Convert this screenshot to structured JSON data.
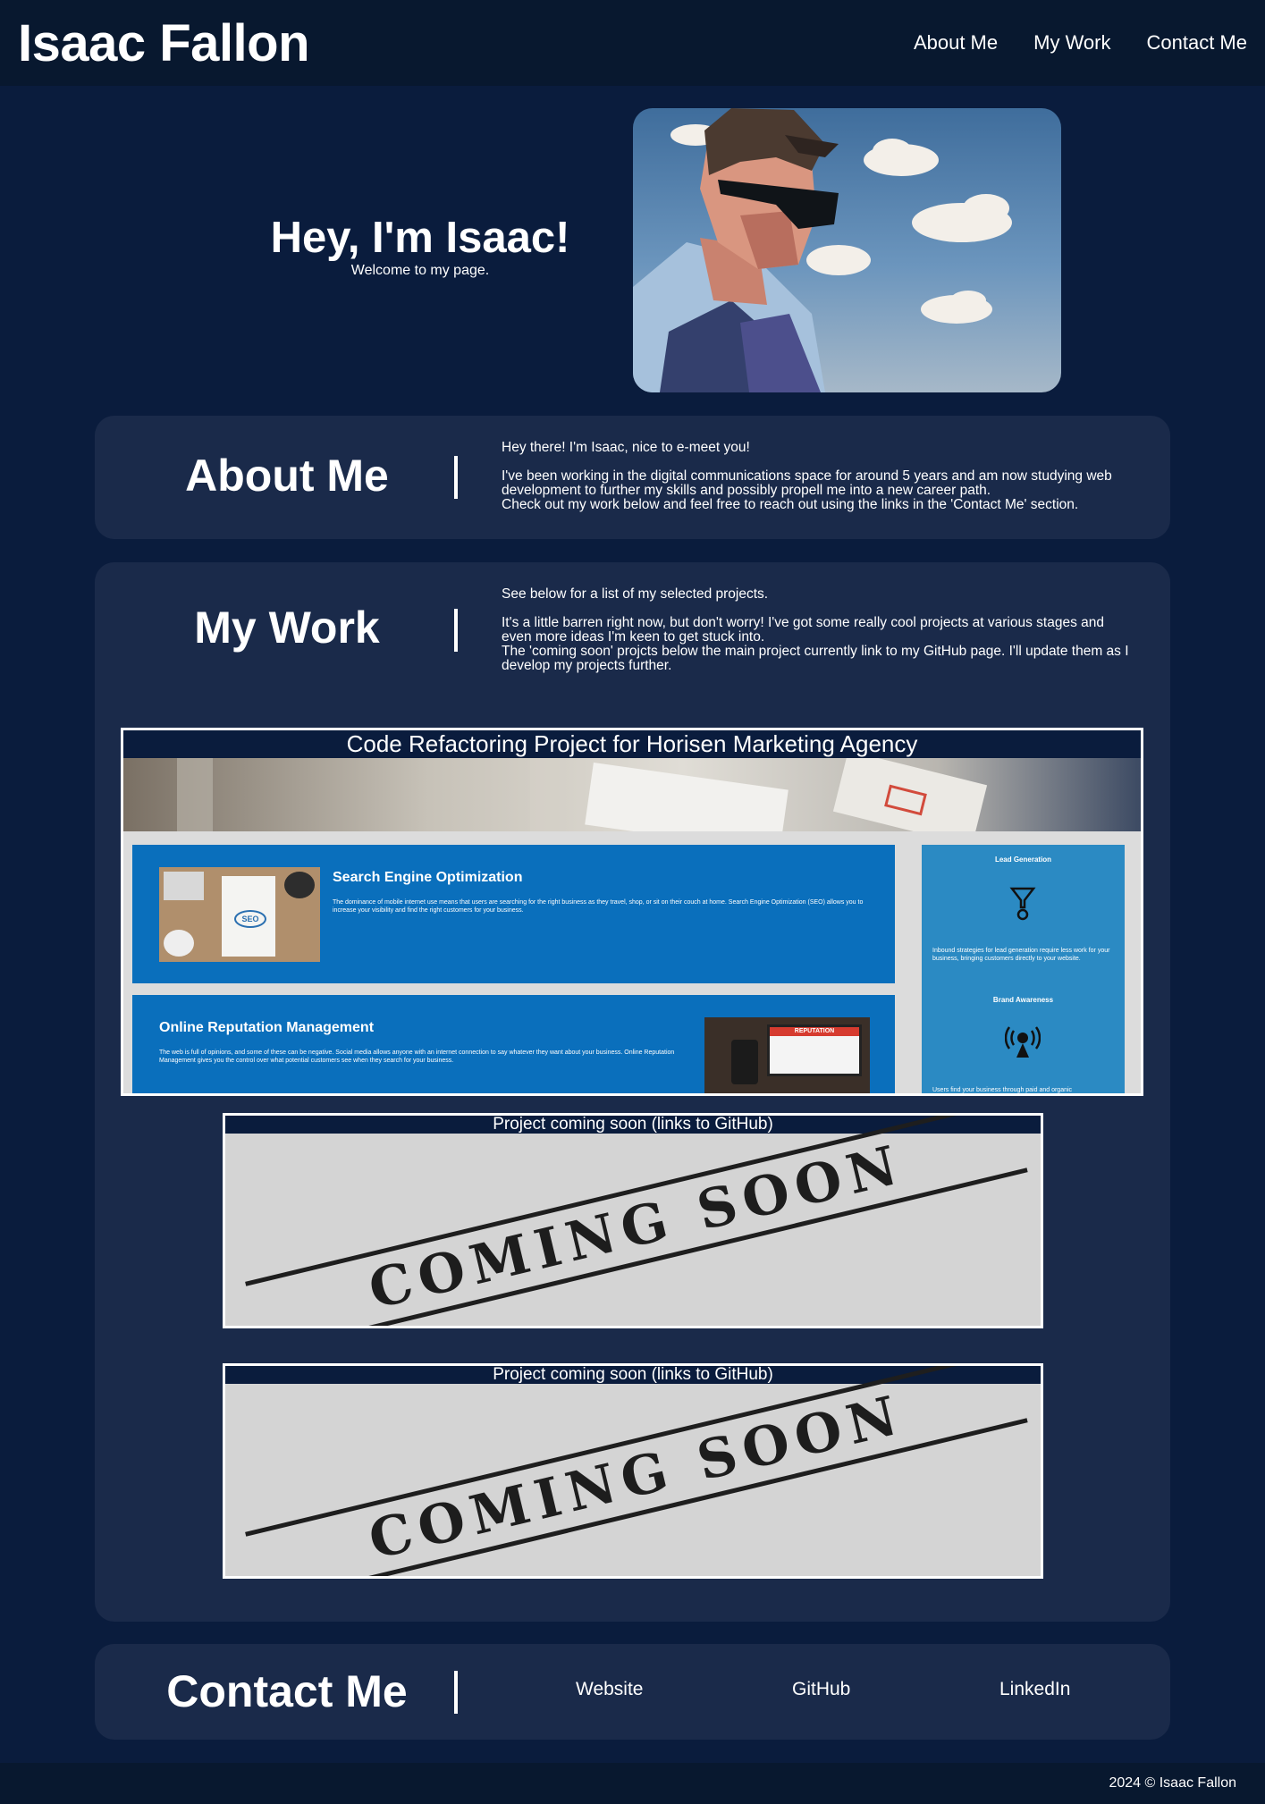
{
  "header": {
    "title": "Isaac Fallon",
    "nav": [
      "About Me",
      "My Work",
      "Contact Me"
    ]
  },
  "hero": {
    "title": "Hey, I'm Isaac!",
    "subtitle": "Welcome to my page."
  },
  "about": {
    "heading": "About Me",
    "paragraphs": [
      "Hey there! I'm Isaac, nice to e-meet you!",
      "I've been working in the digital communications space for around 5 years and am now studying web development to further my skills and possibly propell me into a new career path.",
      "Check out my work below and feel free to reach out using the links in the 'Contact Me' section."
    ]
  },
  "work": {
    "heading": "My Work",
    "paragraphs": [
      "See below for a list of my selected projects.",
      "It's a little barren right now, but don't worry! I've got some really cool projects at various stages and even more ideas I'm keen to get stuck into.",
      "The 'coming soon' projcts below the main project currently link to my GitHub page. I'll update them as I develop my projects further."
    ],
    "main_project": {
      "title": "Code Refactoring Project for Horisen Marketing Agency",
      "preview": {
        "seo_title": "Search Engine Optimization",
        "seo_text": "The dominance of mobile internet use means that users are searching for the right business as they travel, shop, or sit on their couch at home. Search Engine Optimization (SEO) allows you to increase your visibility and find the right customers for your business.",
        "seo_badge": "SEO",
        "orm_title": "Online Reputation Management",
        "orm_text": "The web is full of opinions, and some of these can be negative. Social media allows anyone with an internet connection to say whatever they want about your business. Online Reputation Management gives you the control over what potential customers see when they search for your business.",
        "orm_badge": "REPUTATION",
        "lead_title": "Lead Generation",
        "lead_text": "Inbound strategies for lead generation require less work for your business, bringing customers directly to your website.",
        "brand_title": "Brand Awareness",
        "brand_text": "Users find your business through paid and organic"
      }
    },
    "coming_soon": [
      {
        "title": "Project coming soon (links to GitHub)",
        "stamp": "COMING SOON"
      },
      {
        "title": "Project coming soon (links to GitHub)",
        "stamp": "COMING SOON"
      }
    ]
  },
  "contact": {
    "heading": "Contact Me",
    "links": [
      "Website",
      "GitHub",
      "LinkedIn"
    ]
  },
  "footer": {
    "text": "2024 © Isaac Fallon"
  }
}
